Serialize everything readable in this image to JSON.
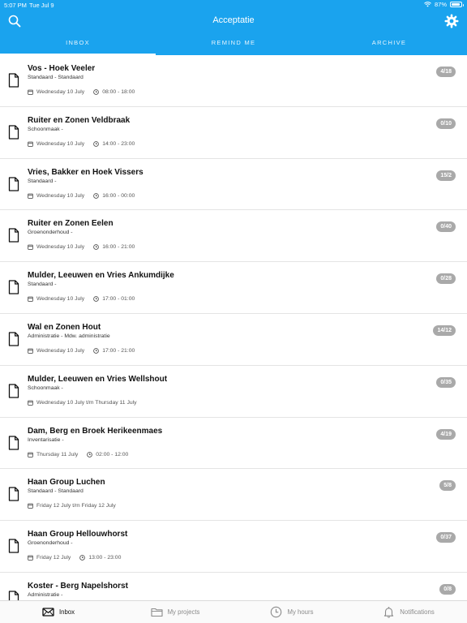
{
  "status_bar": {
    "time": "5:07 PM",
    "date": "Tue Jul 9",
    "battery": "87%",
    "battery_level": 0.87
  },
  "nav": {
    "title": "Acceptatie"
  },
  "tabs": [
    {
      "label": "INBOX",
      "active": true
    },
    {
      "label": "REMIND ME",
      "active": false
    },
    {
      "label": "ARCHIVE",
      "active": false
    }
  ],
  "items": [
    {
      "title": "Vos - Hoek Veeler",
      "subtitle": "Standaard - Standaard",
      "date": "Wednesday 10 July",
      "time": "08:00 - 18:00",
      "badge": "4/18"
    },
    {
      "title": "Ruiter en Zonen Veldbraak",
      "subtitle": "Schoonmaak -",
      "date": "Wednesday 10 July",
      "time": "14:00 - 23:00",
      "badge": "0/10"
    },
    {
      "title": "Vries, Bakker en Hoek Vissers",
      "subtitle": "Standaard -",
      "date": "Wednesday 10 July",
      "time": "16:00 - 00:00",
      "badge": "15/2"
    },
    {
      "title": "Ruiter en Zonen Eelen",
      "subtitle": "Groenonderhoud -",
      "date": "Wednesday 10 July",
      "time": "16:00 - 21:00",
      "badge": "0/40"
    },
    {
      "title": "Mulder, Leeuwen en Vries Ankumdijke",
      "subtitle": "Standaard -",
      "date": "Wednesday 10 July",
      "time": "17:00 - 01:00",
      "badge": "0/28"
    },
    {
      "title": "Wal en Zonen Hout",
      "subtitle": "Administratie - Mdw. administratie",
      "date": "Wednesday 10 July",
      "time": "17:00 - 21:00",
      "badge": "14/12"
    },
    {
      "title": "Mulder, Leeuwen en Vries Wellshout",
      "subtitle": "Schoonmaak -",
      "date": "Wednesday 10 July t/m Thursday 11 July",
      "time": "",
      "badge": "0/35"
    },
    {
      "title": "Dam, Berg en Broek Herikeenmaes",
      "subtitle": "Inventarisatie -",
      "date": "Thursday 11 July",
      "time": "02:00 - 12:00",
      "badge": "4/19"
    },
    {
      "title": "Haan Group Luchen",
      "subtitle": "Standaard - Standaard",
      "date": "Friday 12 July t/m Friday 12 July",
      "time": "",
      "badge": "5/8"
    },
    {
      "title": "Haan Group Hellouwhorst",
      "subtitle": "Groenonderhoud -",
      "date": "Friday 12 July",
      "time": "13:00 - 23:00",
      "badge": "0/37"
    },
    {
      "title": "Koster - Berg Napelshorst",
      "subtitle": "Administratie -",
      "date": "",
      "time": "",
      "badge": "0/8"
    }
  ],
  "tabbar": [
    {
      "label": "Inbox",
      "icon": "envelope-icon",
      "active": true
    },
    {
      "label": "My projects",
      "icon": "folder-icon",
      "active": false
    },
    {
      "label": "My hours",
      "icon": "clock-icon",
      "active": false
    },
    {
      "label": "Notifications",
      "icon": "bell-icon",
      "active": false
    }
  ],
  "colors": {
    "primary": "#1aa3ee",
    "badge": "#a9a9a9"
  }
}
